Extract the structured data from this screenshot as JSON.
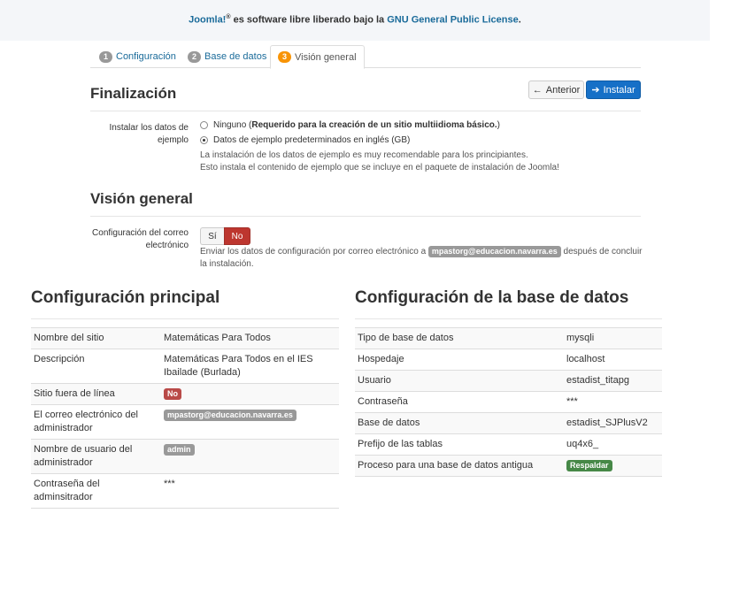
{
  "banner": {
    "joomla": "Joomla!",
    "reg": "®",
    "middle": " es software libre liberado bajo la ",
    "license": "GNU General Public License",
    "end": "."
  },
  "tabs": [
    {
      "num": "1",
      "label": "Configuración"
    },
    {
      "num": "2",
      "label": "Base de datos"
    },
    {
      "num": "3",
      "label": "Visión general"
    }
  ],
  "finalizacion": {
    "title": "Finalización",
    "prev_label": "Anterior",
    "install_label": "Instalar",
    "sample_label": "Instalar los datos de ejemplo",
    "option_none_prefix": "Ninguno (",
    "option_none_bold": "Requerido para la creación de un sitio multiidioma básico.",
    "option_none_suffix": ")",
    "option_default": "Datos de ejemplo predeterminados en inglés (GB)",
    "help_line1": "La instalación de los datos de ejemplo es muy recomendable para los principiantes.",
    "help_line2": "Esto instala el contenido de ejemplo que se incluye en el paquete de instalación de Joomla!"
  },
  "overview": {
    "title": "Visión general",
    "email_label": "Configuración del correo electrónico",
    "yes": "Sí",
    "no": "No",
    "help_prefix": "Enviar los datos de configuración por correo electrónico a ",
    "help_email": "mpastorg@educacion.navarra.es",
    "help_suffix": " después de concluir la instalación."
  },
  "main_config": {
    "title": "Configuración principal",
    "rows": [
      {
        "label": "Nombre del sitio",
        "value": "Matemáticas Para Todos"
      },
      {
        "label": "Descripción",
        "value": "Matemáticas Para Todos en el IES Ibailade (Burlada)"
      },
      {
        "label": "Sitio fuera de línea",
        "value": "No"
      },
      {
        "label": "El correo electrónico del administrador",
        "value": "mpastorg@educacion.navarra.es"
      },
      {
        "label": "Nombre de usuario del administrador",
        "value": "admin"
      },
      {
        "label": "Contraseña del adminsitrador",
        "value": "***"
      }
    ]
  },
  "db_config": {
    "title": "Configuración de la base de datos",
    "rows": [
      {
        "label": "Tipo de base de datos",
        "value": "mysqli"
      },
      {
        "label": "Hospedaje",
        "value": "localhost"
      },
      {
        "label": "Usuario",
        "value": "estadist_titapg"
      },
      {
        "label": "Contraseña",
        "value": "***"
      },
      {
        "label": "Base de datos",
        "value": "estadist_SJPlusV2"
      },
      {
        "label": "Prefijo de las tablas",
        "value": "uq4x6_"
      },
      {
        "label": "Proceso para una base de datos antigua",
        "value": "Respaldar"
      }
    ]
  },
  "colors": {
    "accent": "#1670c7",
    "danger": "#bd362f",
    "success": "#468847",
    "active_step": "#f89406"
  }
}
